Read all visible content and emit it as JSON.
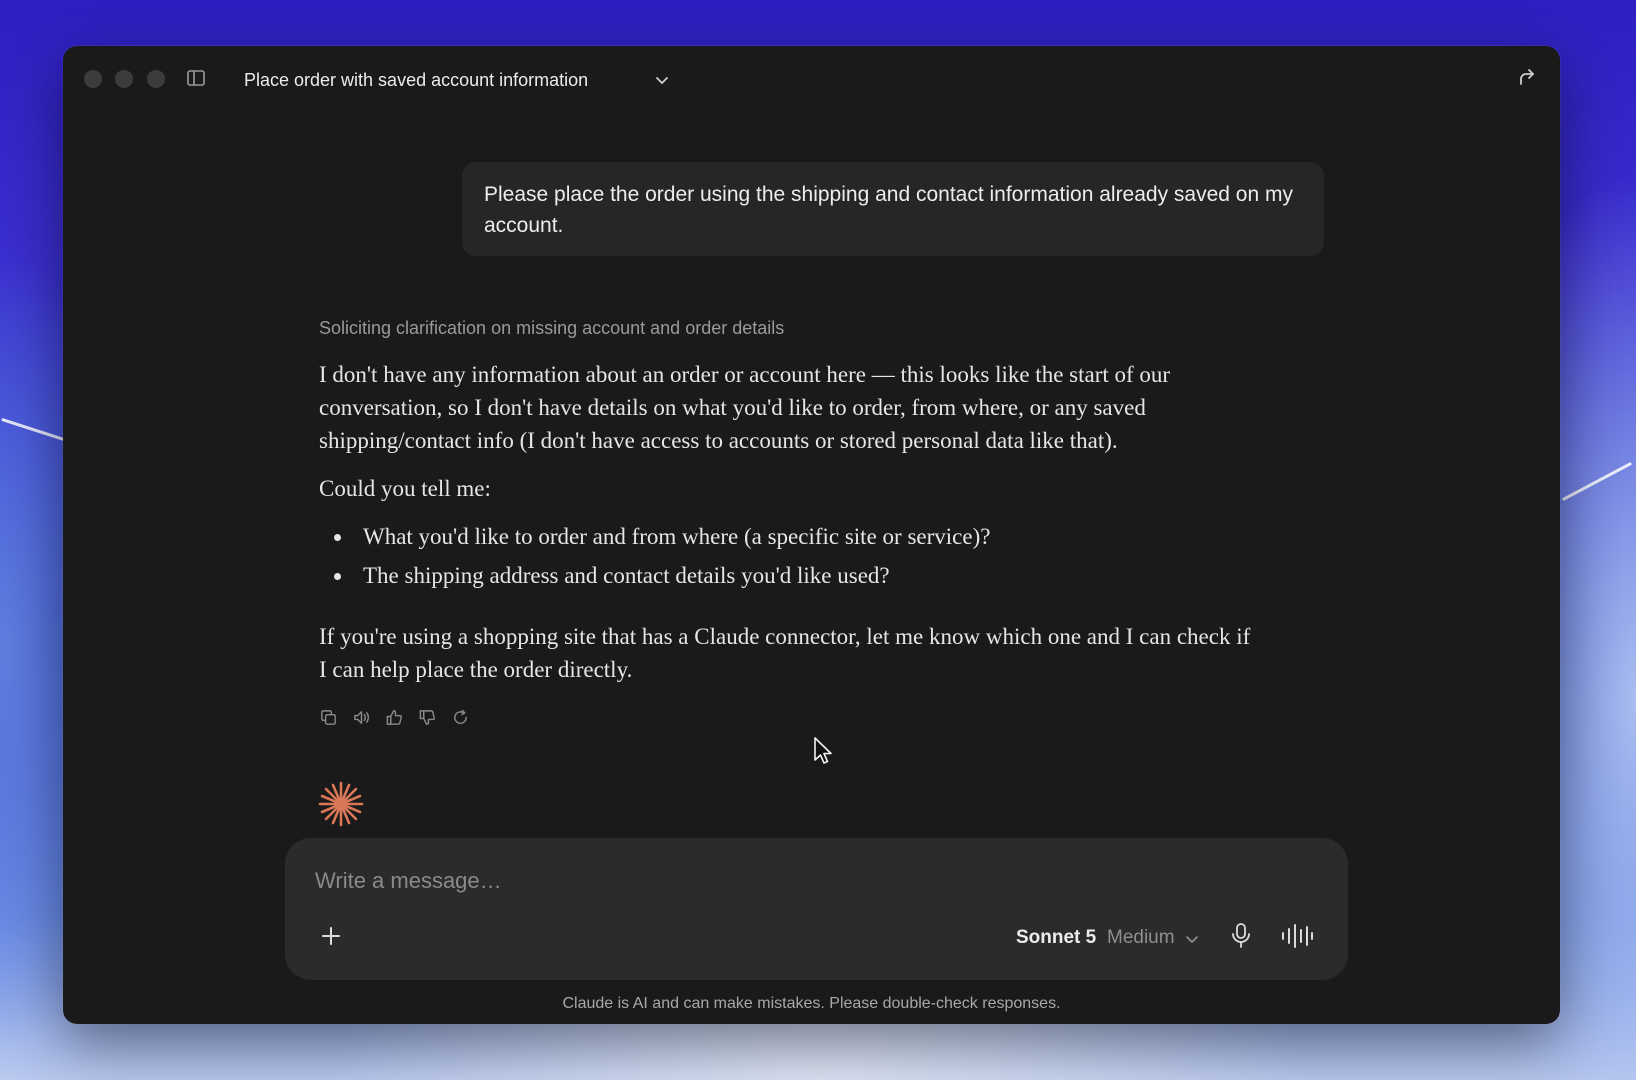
{
  "window": {
    "title": "Place order with saved account information"
  },
  "conversation": {
    "user_message": "Please place the order using the shipping and contact information already saved on my account.",
    "thinking_label": "Soliciting clarification on missing account and order details",
    "assistant_paragraph_1": "I don't have any information about an order or account here — this looks like the start of our conversation, so I don't have details on what you'd like to order, from where, or any saved shipping/contact info (I don't have access to accounts or stored personal data like that).",
    "assistant_paragraph_2": "Could you tell me:",
    "assistant_bullets": [
      "What you'd like to order and from where (a specific site or service)?",
      "The shipping address and contact details you'd like used?"
    ],
    "assistant_paragraph_3": "If you're using a shopping site that has a Claude connector, let me know which one and I can check if I can help place the order directly."
  },
  "composer": {
    "placeholder": "Write a message…",
    "value": "",
    "model_name": "Sonnet 5",
    "effort_level": "Medium"
  },
  "footer": {
    "disclaimer": "Claude is AI and can make mistakes. Please double-check responses."
  },
  "icons": {
    "window_controls": [
      "close-button",
      "minimize-button",
      "zoom-button"
    ],
    "message_actions": [
      "copy-icon",
      "read-aloud-icon",
      "thumbs-up-icon",
      "thumbs-down-icon",
      "retry-icon"
    ]
  },
  "colors": {
    "window_bg": "#1a1a1a",
    "bubble_bg": "#262626",
    "composer_bg": "#2b2b2b",
    "spark_accent": "#d97757"
  }
}
